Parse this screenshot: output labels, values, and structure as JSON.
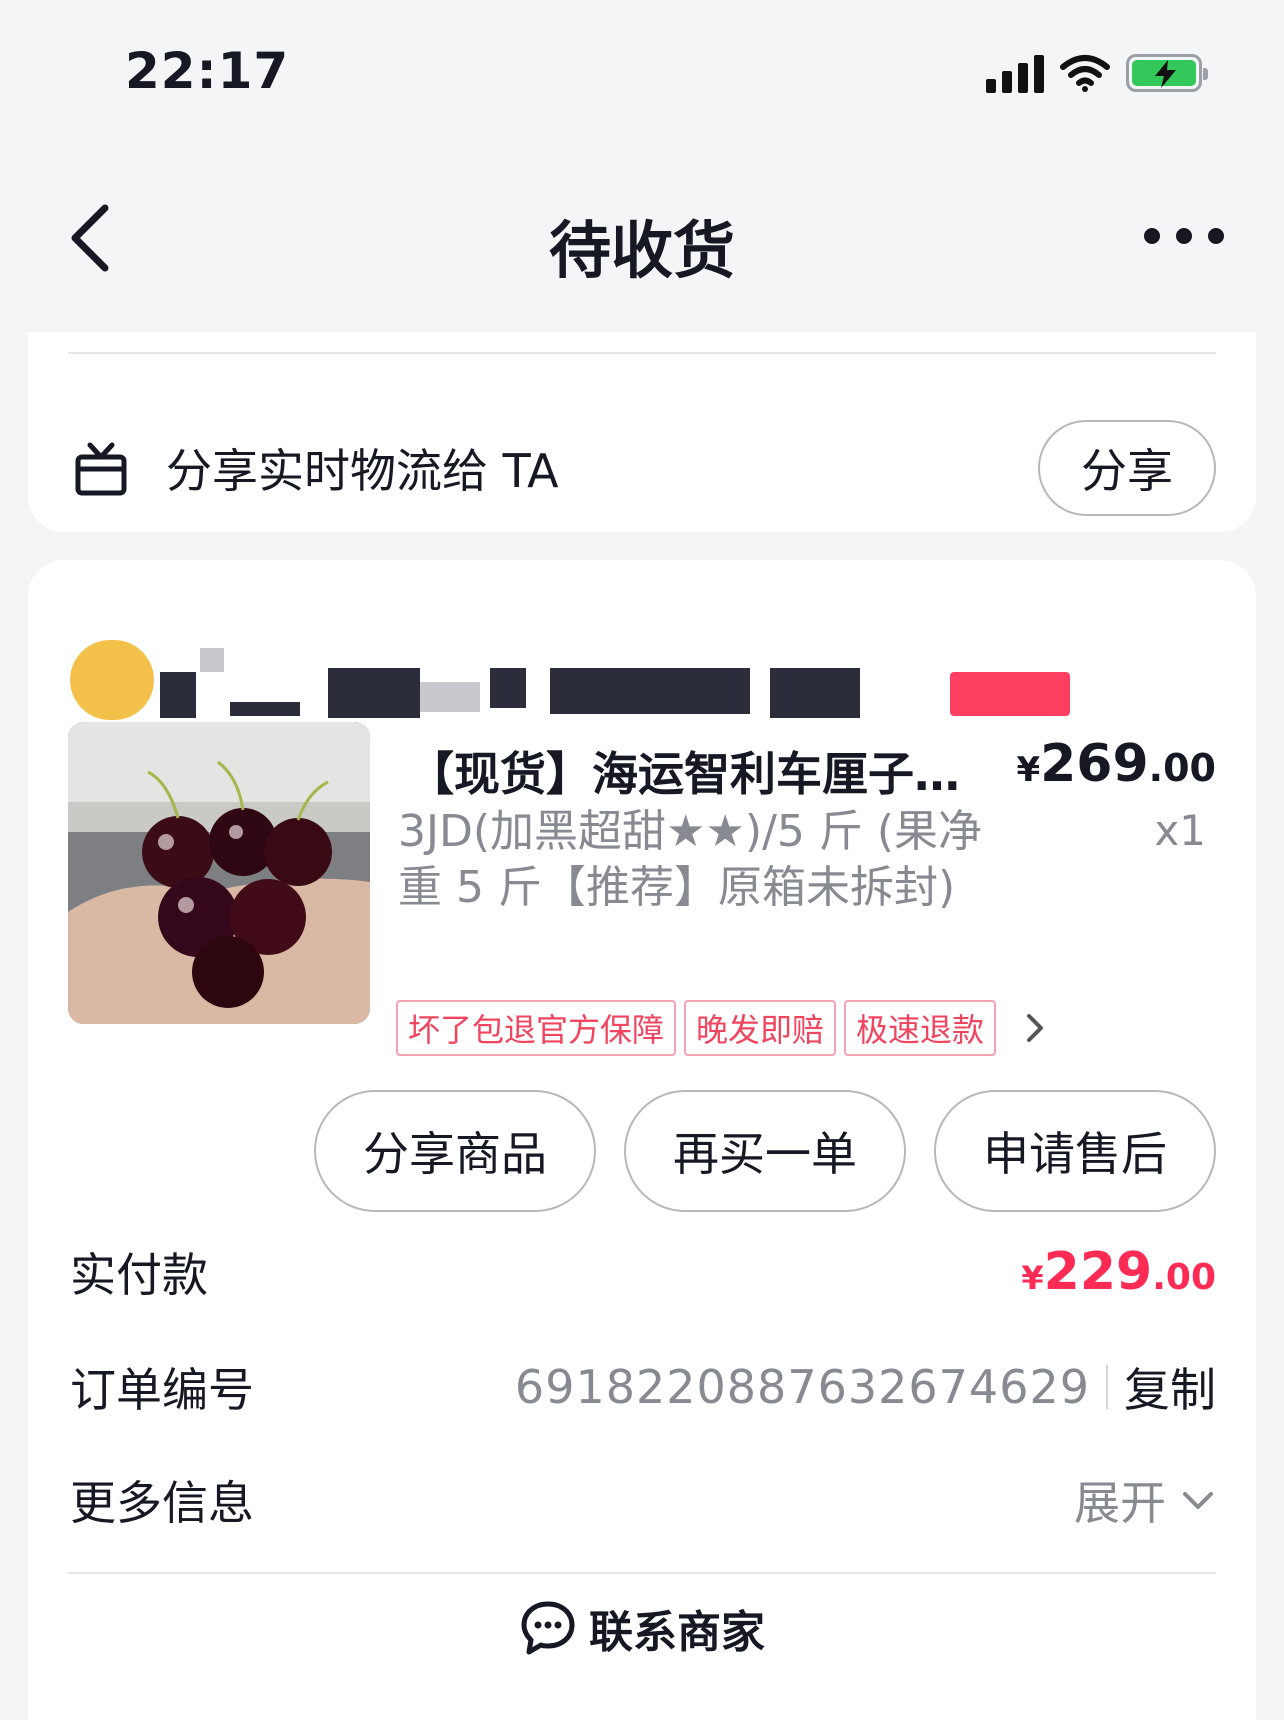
{
  "status_bar": {
    "time": "22:17"
  },
  "nav": {
    "title": "待收货"
  },
  "share_card": {
    "text": "分享实时物流给 TA",
    "button_label": "分享"
  },
  "product": {
    "title": "【现货】海运智利车厘子…",
    "price_yen": "¥",
    "price_int": "269",
    "price_dec": ".00",
    "spec": "3JD(加黑超甜★★)/5 斤 (果净重 5 斤【推荐】原箱未拆封)",
    "quantity": "x1",
    "tags": [
      "坏了包退官方保障",
      "晚发即赔",
      "极速退款"
    ]
  },
  "actions": {
    "share_product": "分享商品",
    "buy_again": "再买一单",
    "after_sale": "申请售后"
  },
  "payment": {
    "label": "实付款",
    "yen": "¥",
    "amount_int": "229",
    "amount_dec": ".00"
  },
  "order": {
    "label": "订单编号",
    "number": "6918220887632674629",
    "copy_label": "复制"
  },
  "more_info": {
    "label": "更多信息",
    "expand_label": "展开"
  },
  "contact": {
    "label": "联系商家"
  },
  "colors": {
    "accent_red": "#fe2c55",
    "tag_border": "#f5a3b4",
    "background": "#f4f5f7"
  }
}
